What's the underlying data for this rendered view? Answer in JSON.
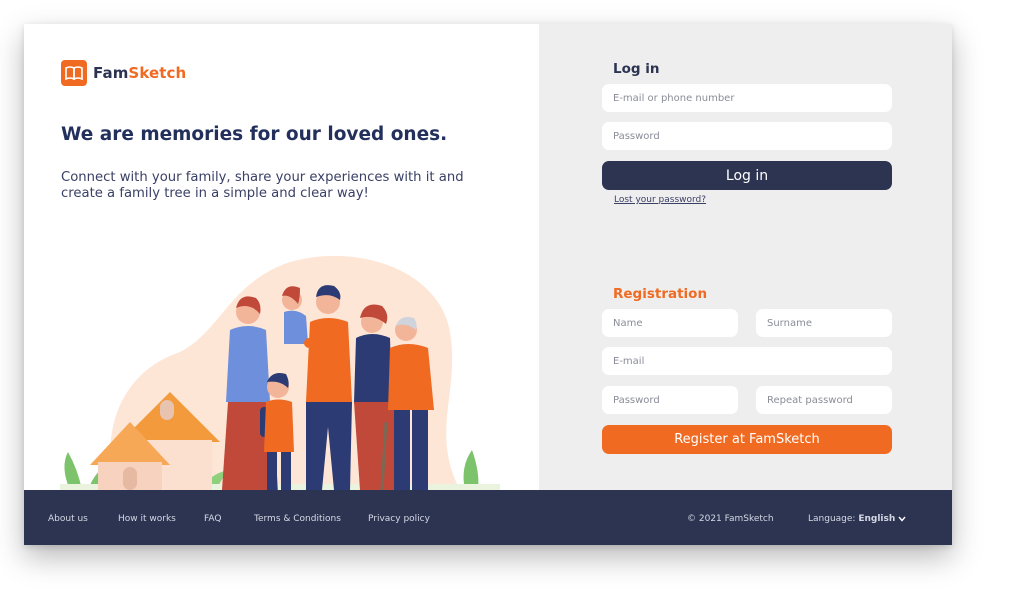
{
  "brand": {
    "name_part1": "Fam",
    "name_part2": "Sketch",
    "accent": "#f06a21",
    "navy": "#2c3451"
  },
  "hero": {
    "headline": "We are memories for our loved ones.",
    "subtext": "Connect with your family, share your experiences with it and create a family tree in a simple and clear way!"
  },
  "login": {
    "title": "Log in",
    "email_placeholder": "E-mail or phone number",
    "password_placeholder": "Password",
    "button": "Log in",
    "forgot": "Lost your password?"
  },
  "registration": {
    "title": "Registration",
    "name_placeholder": "Name",
    "surname_placeholder": "Surname",
    "email_placeholder": "E-mail",
    "password_placeholder": "Password",
    "repeat_password_placeholder": "Repeat password",
    "button": "Register at FamSketch"
  },
  "footer": {
    "links": [
      "About us",
      "How it works",
      "FAQ",
      "Terms & Conditions",
      "Privacy policy"
    ],
    "copyright": "© 2021 FamSketch",
    "language_label": "Language:",
    "language_value": "English",
    "language_chevron": "chevron-down-icon"
  }
}
